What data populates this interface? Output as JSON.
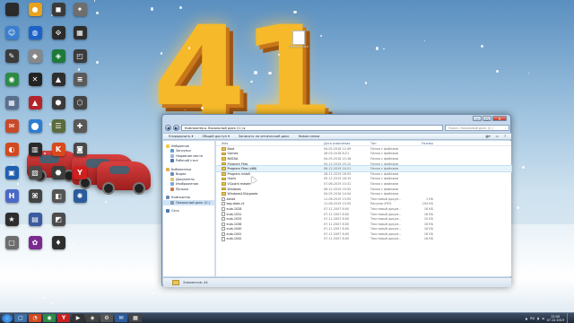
{
  "desktop": {
    "big_text": "41",
    "new_folder_label": "Новая папка",
    "icons": [
      {
        "label": "",
        "glyph": "",
        "color": "#2a2a2a"
      },
      {
        "label": "",
        "glyph": "☺",
        "color": "#3a7fcf"
      },
      {
        "label": "",
        "glyph": "✎",
        "color": "#3b3b3b"
      },
      {
        "label": "",
        "glyph": "◉",
        "color": "#2e8a46"
      },
      {
        "label": "",
        "glyph": "▦",
        "color": "#5a6f8f"
      },
      {
        "label": "",
        "glyph": "✉",
        "color": "#c74a2b"
      },
      {
        "label": "",
        "glyph": "◐",
        "color": "#d24a20"
      },
      {
        "label": "",
        "glyph": "▣",
        "color": "#1f5fb0"
      },
      {
        "label": "",
        "glyph": "H",
        "color": "#4a69c7"
      },
      {
        "label": "",
        "glyph": "★",
        "color": "#2d2d2d"
      },
      {
        "label": "",
        "glyph": "▢",
        "color": "#6d6d6d"
      },
      {
        "label": "",
        "glyph": "●",
        "color": "#e8a21c"
      },
      {
        "label": "",
        "glyph": "◍",
        "color": "#1b63c9"
      },
      {
        "label": "",
        "glyph": "◆",
        "color": "#888"
      },
      {
        "label": "",
        "glyph": "✕",
        "color": "#222"
      },
      {
        "label": "",
        "glyph": "▲",
        "color": "#b6242b"
      },
      {
        "label": "",
        "glyph": "⬤",
        "color": "#2f7dd3"
      },
      {
        "label": "",
        "glyph": "▥",
        "color": "#2a2a2a"
      },
      {
        "label": "",
        "glyph": "▧",
        "color": "#4a4a4a"
      },
      {
        "label": "",
        "glyph": "⌘",
        "color": "#444"
      },
      {
        "label": "",
        "glyph": "▤",
        "color": "#3b5ba0"
      },
      {
        "label": "",
        "glyph": "✿",
        "color": "#7b2a8f"
      },
      {
        "label": "",
        "glyph": "◼",
        "color": "#3a3a3a"
      },
      {
        "label": "",
        "glyph": "⟐",
        "color": "#2b2b2b"
      },
      {
        "label": "",
        "glyph": "◈",
        "color": "#1d7a3a"
      },
      {
        "label": "",
        "glyph": "▲",
        "color": "#2e2e2e"
      },
      {
        "label": "",
        "glyph": "⬢",
        "color": "#3a3a3a"
      },
      {
        "label": "",
        "glyph": "☰",
        "color": "#5b6b3b"
      },
      {
        "label": "",
        "glyph": "K",
        "color": "#d8491c"
      },
      {
        "label": "",
        "glyph": "⬣",
        "color": "#3d3d3d"
      },
      {
        "label": "",
        "glyph": "◧",
        "color": "#555"
      },
      {
        "label": "",
        "glyph": "◩",
        "color": "#4b4b4b"
      },
      {
        "label": "",
        "glyph": "♦",
        "color": "#2e2e2e"
      },
      {
        "label": "",
        "glyph": "✦",
        "color": "#6e6e6e"
      },
      {
        "label": "",
        "glyph": "▦",
        "color": "#2e2e2e"
      },
      {
        "label": "",
        "glyph": "◰",
        "color": "#3b3b3b"
      },
      {
        "label": "",
        "glyph": "≡",
        "color": "#5a5a5a"
      },
      {
        "label": "",
        "glyph": "⬡",
        "color": "#444"
      },
      {
        "label": "",
        "glyph": "✚",
        "color": "#585858"
      },
      {
        "label": "",
        "glyph": "◙",
        "color": "#484848"
      },
      {
        "label": "",
        "glyph": "Y",
        "color": "#d01f1f"
      },
      {
        "label": "",
        "glyph": "✺",
        "color": "#2b5b9b"
      }
    ]
  },
  "window": {
    "address": "Компьютер ▸ Локальный диск (C:) ▸",
    "search_placeholder": "Поиск: Локальный диск (C:)",
    "toolbar": [
      "Упорядочить ▾",
      "Общий доступ ▾",
      "Записать на оптический диск",
      "Новая папка"
    ],
    "nav": [
      {
        "label": "Избранное",
        "color": "#f2c94c",
        "type": "group"
      },
      {
        "label": "Загрузки",
        "color": "#5b9bd5",
        "type": "item"
      },
      {
        "label": "Недавние места",
        "color": "#9bb7d4",
        "type": "item"
      },
      {
        "label": "Рабочий стол",
        "color": "#4a7ab5",
        "type": "item"
      },
      {
        "label": "",
        "type": "gap"
      },
      {
        "label": "Библиотеки",
        "color": "#e0b050",
        "type": "group"
      },
      {
        "label": "Видео",
        "color": "#6a8cbf",
        "type": "item"
      },
      {
        "label": "Документы",
        "color": "#d9c27a",
        "type": "item"
      },
      {
        "label": "Изображения",
        "color": "#7aa8d9",
        "type": "item"
      },
      {
        "label": "Музыка",
        "color": "#c77a4a",
        "type": "item"
      },
      {
        "label": "",
        "type": "gap"
      },
      {
        "label": "Компьютер",
        "color": "#6b8cb0",
        "type": "group"
      },
      {
        "label": "Локальный диск (C:)",
        "color": "#8a9aab",
        "type": "sel"
      },
      {
        "label": "",
        "type": "gap"
      },
      {
        "label": "Сеть",
        "color": "#4a7ab5",
        "type": "group"
      }
    ],
    "columns": {
      "name": "Имя",
      "date": "Дата изменения",
      "type": "Тип",
      "size": "Размер"
    },
    "rows": [
      {
        "name": "Boot",
        "date": "04.05.2018 12:49",
        "type": "Папка с файлами",
        "size": "",
        "kind": "folder"
      },
      {
        "name": "Games",
        "date": "28.03.2018 8:21",
        "type": "Папка с файлами",
        "size": "",
        "kind": "folder"
      },
      {
        "name": "NVIDIA",
        "date": "04.05.2018 15:18",
        "type": "Папка с файлами",
        "size": "",
        "kind": "folder"
      },
      {
        "name": "Program Files",
        "date": "05.12.2019 19:12",
        "type": "Папка с файлами",
        "size": "",
        "kind": "folder"
      },
      {
        "name": "Program Files (x86)",
        "date": "06.12.2019 14:21",
        "type": "Папка с файлами",
        "size": "",
        "kind": "folder",
        "hover": true
      },
      {
        "name": "Program install",
        "date": "28.11.2019 18:53",
        "type": "Папка с файлами",
        "size": "",
        "kind": "folder"
      },
      {
        "name": "Users",
        "date": "05.12.2019 18:15",
        "type": "Папка с файлами",
        "size": "",
        "kind": "folder"
      },
      {
        "name": "VCpoint master",
        "date": "07.06.2019 10:31",
        "type": "Папка с файлами",
        "size": "",
        "kind": "folder"
      },
      {
        "name": "Windows",
        "date": "06.12.2019 19:35",
        "type": "Папка с файлами",
        "size": "",
        "kind": "folder"
      },
      {
        "name": "Windows10Upgrade",
        "date": "04.05.2018 14:54",
        "type": "Папка с файлами",
        "size": "",
        "kind": "folder"
      },
      {
        "name": "abnet",
        "date": "11.08.2019 13:55",
        "type": "Текстовый докум...",
        "size": "1 КБ",
        "kind": "file"
      },
      {
        "name": "bsg-data-v1",
        "date": "11.08.2019 13:55",
        "type": "Рисунок JPEG",
        "size": "194 КБ",
        "kind": "file"
      },
      {
        "name": "eula.1028",
        "date": "07.11.2007 8:00",
        "type": "Текстовый докум...",
        "size": "18 КБ",
        "kind": "file"
      },
      {
        "name": "eula.1031",
        "date": "07.11.2007 8:00",
        "type": "Текстовый докум...",
        "size": "18 КБ",
        "kind": "file"
      },
      {
        "name": "eula.1033",
        "date": "07.11.2007 8:00",
        "type": "Текстовый докум...",
        "size": "10 КБ",
        "kind": "file"
      },
      {
        "name": "eula.1036",
        "date": "07.11.2007 8:00",
        "type": "Текстовый докум...",
        "size": "18 КБ",
        "kind": "file"
      },
      {
        "name": "eula.1040",
        "date": "07.11.2007 8:00",
        "type": "Текстовый докум...",
        "size": "18 КБ",
        "kind": "file"
      },
      {
        "name": "eula.1041",
        "date": "07.11.2007 8:00",
        "type": "Текстовый докум...",
        "size": "18 КБ",
        "kind": "file"
      },
      {
        "name": "eula.1042",
        "date": "07.11.2007 8:00",
        "type": "Текстовый докум...",
        "size": "18 КБ",
        "kind": "file"
      }
    ],
    "status": "Элементов: 44"
  },
  "taskbar": {
    "items": [
      {
        "glyph": "▢",
        "color": "#3d6fa8"
      },
      {
        "glyph": "◔",
        "color": "#d24a20"
      },
      {
        "glyph": "◉",
        "color": "#2e8a46"
      },
      {
        "glyph": "Y",
        "color": "#c91f1f"
      },
      {
        "glyph": "▶",
        "color": "#333"
      },
      {
        "glyph": "◈",
        "color": "#444"
      },
      {
        "glyph": "⚙",
        "color": "#555"
      },
      {
        "glyph": "✉",
        "color": "#2b5b9b"
      },
      {
        "glyph": "▦",
        "color": "#444"
      }
    ],
    "lang": "RU",
    "time": "22:00",
    "date": "07.12.2019"
  }
}
